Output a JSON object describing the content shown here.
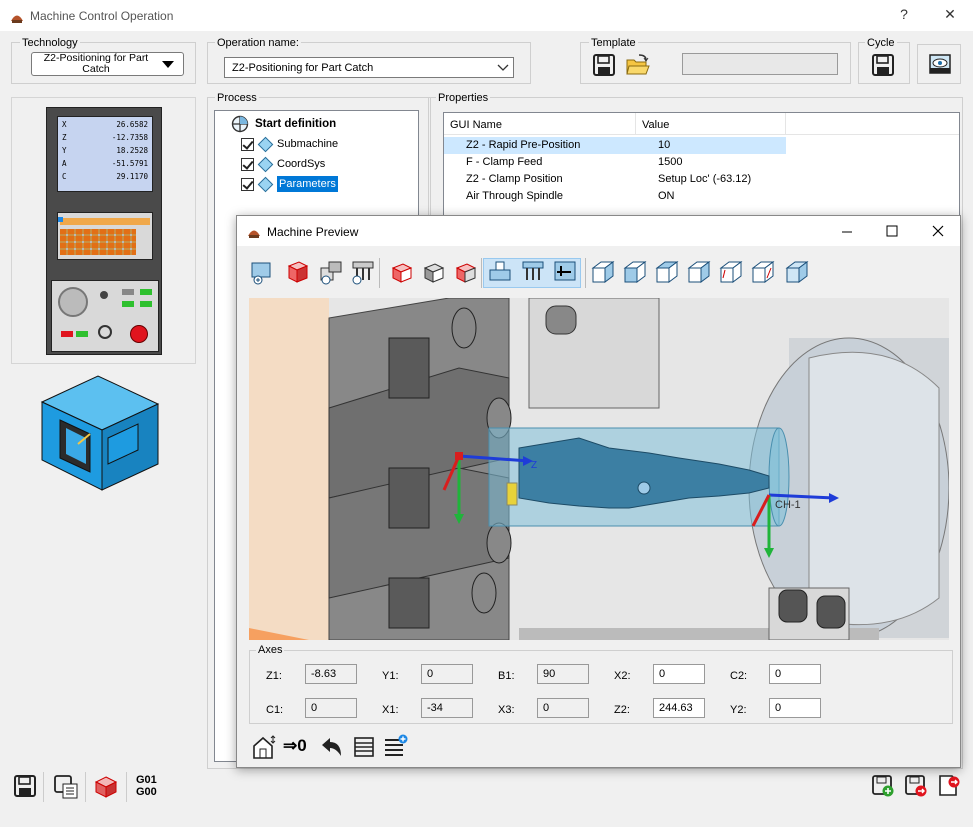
{
  "window": {
    "title": "Machine Control Operation",
    "help": "?",
    "close": "✕"
  },
  "technology": {
    "label": "Technology",
    "value": "Z2-Positioning for Part Catch"
  },
  "operation": {
    "label": "Operation name:",
    "value": "Z2-Positioning for Part Catch"
  },
  "template": {
    "label": "Template"
  },
  "cycle": {
    "label": "Cycle"
  },
  "process": {
    "label": "Process",
    "root": "Start definition",
    "items": [
      "Submachine",
      "CoordSys",
      "Parameters"
    ]
  },
  "properties": {
    "label": "Properties",
    "headers": [
      "GUI Name",
      "Value"
    ],
    "rows": [
      {
        "name": "Z2 - Rapid Pre-Position",
        "value": "10"
      },
      {
        "name": "F - Clamp Feed",
        "value": "1500"
      },
      {
        "name": "Z2 - Clamp Position",
        "value": "Setup Loc' (-63.12)"
      },
      {
        "name": "Air Through Spindle",
        "value": "ON"
      }
    ]
  },
  "controller": {
    "readout": [
      {
        "axis": "X",
        "val": "26.6582"
      },
      {
        "axis": "Z",
        "val": "-12.7358"
      },
      {
        "axis": "Y",
        "val": "18.2528"
      },
      {
        "axis": "A",
        "val": "-51.5791"
      },
      {
        "axis": "C",
        "val": "29.1170"
      }
    ]
  },
  "bottom": {
    "gcode": "G01\nG00",
    "g01": "G01",
    "g00": "G00"
  },
  "preview": {
    "title": "Machine Preview",
    "axes_label": "Axes",
    "axes_row1": [
      {
        "label": "Z1:",
        "value": "-8.63",
        "ro": true
      },
      {
        "label": "Y1:",
        "value": "0",
        "ro": true
      },
      {
        "label": "B1:",
        "value": "90",
        "ro": true
      },
      {
        "label": "X2:",
        "value": "0",
        "ro": false
      },
      {
        "label": "C2:",
        "value": "0",
        "ro": false
      }
    ],
    "axes_row2": [
      {
        "label": "C1:",
        "value": "0",
        "ro": true
      },
      {
        "label": "X1:",
        "value": "-34",
        "ro": true
      },
      {
        "label": "X3:",
        "value": "0",
        "ro": true
      },
      {
        "label": "Z2:",
        "value": "244.63",
        "ro": false
      },
      {
        "label": "Y2:",
        "value": "0",
        "ro": false
      }
    ],
    "zero_label": "⇒0",
    "scene_label": "CH-1",
    "axis_z": "Z"
  },
  "colors": {
    "accent": "#0078d7",
    "machine_blue": "#1e9be0",
    "part": "#3c7fa3",
    "red_btn": "#e0141e"
  }
}
